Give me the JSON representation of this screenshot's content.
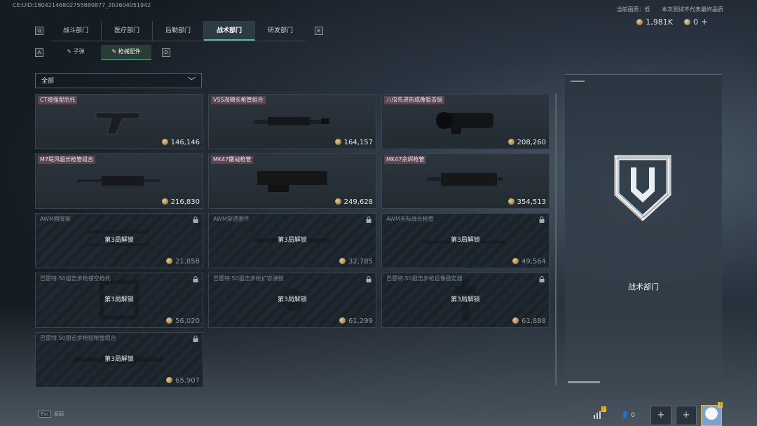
{
  "build_id": "CE:UID:18042146802755880877_202604051942",
  "header": {
    "title": "",
    "mode_label": "当前画质：低",
    "disclaimer": "本次测试不代表最终品质",
    "currency": [
      {
        "icon": "gold-coin-icon",
        "value": "1,981K"
      },
      {
        "icon": "silver-coin-icon",
        "value": "0"
      }
    ],
    "plus_label": "+"
  },
  "tabs": {
    "left_key": "Q",
    "right_key": "E",
    "items": [
      {
        "label": "战斗部门",
        "active": false
      },
      {
        "label": "医疗部门",
        "active": false
      },
      {
        "label": "后勤部门",
        "active": false
      },
      {
        "label": "战术部门",
        "active": true
      },
      {
        "label": "研发部门",
        "active": false
      }
    ]
  },
  "subtabs": {
    "left_key": "A",
    "right_key": "D",
    "items": [
      {
        "label": "子弹",
        "icon": "pencil-icon",
        "active": false
      },
      {
        "label": "枪械配件",
        "icon": "pencil-icon",
        "active": true
      }
    ]
  },
  "filter": {
    "selected": "全部"
  },
  "items": [
    {
      "name": "CT增强型后托",
      "price": "146,146",
      "locked": false
    },
    {
      "name": "VSS海啸长枪管组合",
      "price": "164,157",
      "locked": false
    },
    {
      "name": "八倍先进热成像狙击镜",
      "price": "208,260",
      "locked": false
    },
    {
      "name": "M7堤风超长枪管组合",
      "price": "216,830",
      "locked": false
    },
    {
      "name": "MK47鏖战枪管",
      "price": "249,628",
      "locked": false
    },
    {
      "name": "MK47余烬枪管",
      "price": "354,513",
      "locked": false
    },
    {
      "name": "AWM两脚架",
      "price": "21,858",
      "locked": true,
      "unlock": "第3局解锁"
    },
    {
      "name": "AWM穿透套件",
      "price": "32,785",
      "locked": true,
      "unlock": "第3局解锁"
    },
    {
      "name": "AWM天际线长枪管",
      "price": "49,564",
      "locked": true,
      "unlock": "第3局解锁"
    },
    {
      "name": "巴雷特.50狙击步枪镂空枪托",
      "price": "56,020",
      "locked": true,
      "unlock": "第3局解锁"
    },
    {
      "name": "巴雷特.50狙击步枪扩容弹鼓",
      "price": "61,299",
      "locked": true,
      "unlock": "第3局解锁"
    },
    {
      "name": "巴雷特.50狙击步枪巨像稳定器",
      "price": "61,888",
      "locked": true,
      "unlock": "第3局解锁"
    },
    {
      "name": "巴雷特.50狙击步枪短枪管组合",
      "price": "65,907",
      "locked": true,
      "unlock": "第3局解锁"
    }
  ],
  "panel": {
    "department_name": "战术部门",
    "emblem": "tactical-department-emblem"
  },
  "footer": {
    "esc_key": "Esc",
    "esc_label": "返回",
    "friends_count": "0",
    "slot_plus": "+"
  },
  "colors": {
    "accent": "#4fbf9a",
    "label_bg": "#5a4652",
    "badge": "#e7b43a"
  }
}
